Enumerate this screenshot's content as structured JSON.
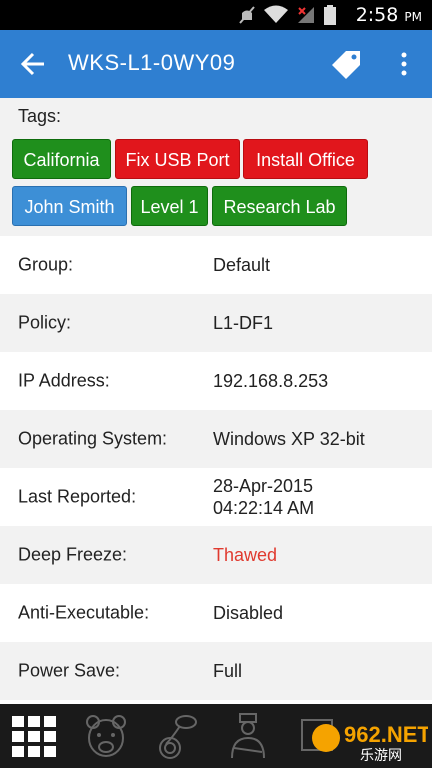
{
  "status_bar": {
    "time": "2:58",
    "ampm": "PM"
  },
  "app_bar": {
    "title": "WKS-L1-0WY09"
  },
  "tags_section": {
    "label": "Tags:",
    "tags": [
      {
        "text": "California",
        "color": "#1f8f1c"
      },
      {
        "text": "Fix USB Port",
        "color": "#e1161c"
      },
      {
        "text": "Install Office",
        "color": "#e1161c"
      },
      {
        "text": "John Smith",
        "color": "#3d8fd6"
      },
      {
        "text": "Level 1",
        "color": "#1f8f1c"
      },
      {
        "text": "Research Lab",
        "color": "#1f8f1c"
      }
    ]
  },
  "details": [
    {
      "label": "Group:",
      "value": "Default"
    },
    {
      "label": "Policy:",
      "value": "L1-DF1"
    },
    {
      "label": "IP Address:",
      "value": "192.168.8.253"
    },
    {
      "label": "Operating System:",
      "value": "Windows XP 32-bit"
    },
    {
      "label": "Last Reported:",
      "value_line1": "28-Apr-2015",
      "value_line2": "04:22:14 AM"
    },
    {
      "label": "Deep Freeze:",
      "value": "Thawed",
      "value_color": "#e03a2f"
    },
    {
      "label": "Anti-Executable:",
      "value": "Disabled"
    },
    {
      "label": "Power Save:",
      "value": "Full"
    }
  ],
  "bottom_nav": {
    "items": [
      "grid-icon",
      "bear-icon",
      "tuba-icon",
      "person-icon",
      "item-icon"
    ]
  },
  "watermark": {
    "text": "962.NET",
    "subtext": "乐游网"
  },
  "colors": {
    "app_bar": "#2f7fd1",
    "row_alt": "#f2f2f2",
    "nav_bg": "#1a1a1a"
  }
}
